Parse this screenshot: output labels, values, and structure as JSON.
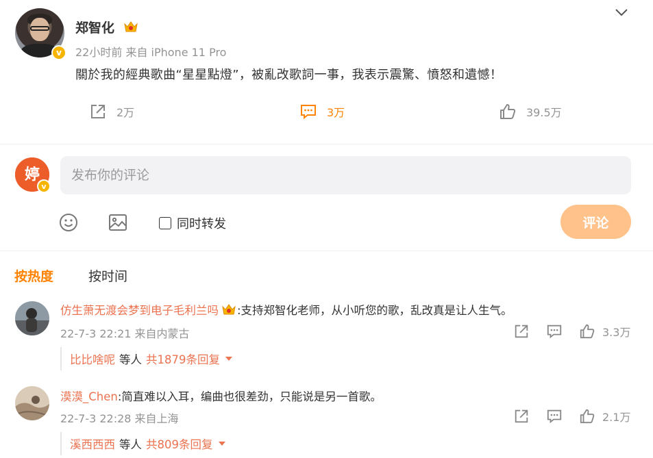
{
  "post": {
    "author": "郑智化",
    "meta": "22小时前  来自 iPhone 11 Pro",
    "text": "關於我的經典歌曲“星星點燈”，被亂改歌詞一事，我表示震驚、憤怒和遺憾！",
    "verified_icon": "v",
    "actions": {
      "repost_count": "2万",
      "comment_count": "3万",
      "like_count": "39.5万"
    }
  },
  "compose": {
    "placeholder": "发布你的评论",
    "repost_label": "同时转发",
    "submit_label": "评论"
  },
  "sort": {
    "hot_label": "按热度",
    "time_label": "按时间"
  },
  "comments": [
    {
      "author": "仿生萧无渡会梦到电子毛利兰吗",
      "text": ":支持郑智化老师，从小听您的歌，乱改真是让人生气。",
      "meta": "22-7-3 22:21 来自内蒙古",
      "like_count": "3.3万",
      "reply_user": "比比啥呢",
      "reply_mid": "等人",
      "reply_count": "共1879条回复"
    },
    {
      "author": "漠漠_Chen",
      "text": ":简直难以入耳，编曲也很差劲，只能说是另一首歌。",
      "meta": "22-7-3 22:28 来自上海",
      "like_count": "2.1万",
      "reply_user": "溪西西西",
      "reply_mid": "等人",
      "reply_count": "共809条回复"
    }
  ],
  "colors": {
    "accent": "#ff8200",
    "link": "#eb7350",
    "muted": "#939393",
    "submit_disabled": "#ffc28a",
    "input_bg": "#f2f2f5"
  }
}
